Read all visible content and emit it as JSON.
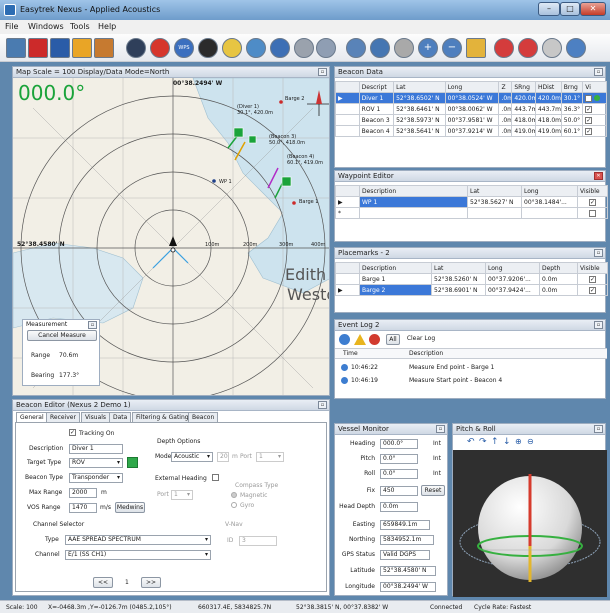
{
  "window": {
    "title": "Easytrek Nexus - Applied Acoustics"
  },
  "menu": [
    "File",
    "Windows",
    "Tools",
    "Help"
  ],
  "map": {
    "header": "Map Scale = 100 Display/Data Mode=North",
    "heading": "000.0°",
    "lon_label": "00°38.2494' W",
    "lat_label": "52°38.4580' N",
    "range_rings": [
      "100m",
      "200m",
      "300m",
      "400m"
    ],
    "labels": {
      "barge2": "Barge 2",
      "diver1": "(Diver 1)\n30.1°, 420.0m",
      "beacon3": "(Beacon 3)\n50.0°, 418.0m",
      "beacon4": "(Beacon 4)\n60.1°, 419.0m",
      "wp1": "WP 1",
      "barge1": "Barge 1"
    },
    "place1": "Edith",
    "place2": "Westo",
    "measurement": {
      "title": "Measurement",
      "cancel": "Cancel Measure",
      "range_label": "Range",
      "range_value": "70.6m",
      "bearing_label": "Bearing",
      "bearing_value": "177.3°"
    }
  },
  "beacon_data": {
    "title": "Beacon Data",
    "columns": [
      "Descript",
      "Lat",
      "Long",
      "Z",
      "SRng",
      "HDist",
      "Brng",
      "Vi"
    ],
    "rows": [
      [
        "Diver 1",
        "52°38.6502' N",
        "00°38.0524' W",
        ".0m",
        "420.0m",
        "420.0m",
        "30.1°"
      ],
      [
        "ROV 1",
        "52°38.6461' N",
        "00°38.0062' W",
        ".0m",
        "443.7m",
        "443.7m",
        "36.3°"
      ],
      [
        "Beacon 3",
        "52°38.5973' N",
        "00°37.9581' W",
        ".0m",
        "418.0m",
        "418.0m",
        "50.0°"
      ],
      [
        "Beacon 4",
        "52°38.5641' N",
        "00°37.9214' W",
        ".0m",
        "419.0m",
        "419.0m",
        "60.1°"
      ]
    ]
  },
  "waypoint_editor": {
    "title": "Waypoint Editor",
    "columns": [
      "Description",
      "Lat",
      "Long",
      "Visible"
    ],
    "rows": [
      [
        "WP 1",
        "52°38.5627' N",
        "00°38.1484'..."
      ]
    ]
  },
  "placemarks": {
    "title": "Placemarks - 2",
    "columns": [
      "Description",
      "Lat",
      "Long",
      "Depth",
      "Visible"
    ],
    "rows": [
      [
        "Barge 1",
        "52°38.5260' N",
        "00°37.9206'...",
        "0.0m"
      ],
      [
        "Barge 2",
        "52°38.6901' N",
        "00°37.9424'...",
        "0.0m"
      ]
    ]
  },
  "event_log": {
    "title": "Event Log 2",
    "all": "All",
    "clear": "Clear Log",
    "columns": [
      "Time",
      "Description"
    ],
    "rows": [
      [
        "10:46:22",
        "Measure End point - Barge 1"
      ],
      [
        "10:46:19",
        "Measure Start point - Beacon 4"
      ]
    ]
  },
  "beacon_editor": {
    "title": "Beacon Editor (Nexus 2 Demo 1)",
    "tabs": [
      "General",
      "Receiver",
      "Visuals",
      "Data",
      "Filtering & Gating",
      "Beacon"
    ],
    "tracking_on": "Tracking On",
    "description_label": "Description",
    "description_value": "Diver 1",
    "target_type_label": "Target Type",
    "target_type_value": "ROV",
    "beacon_type_label": "Beacon Type",
    "beacon_type_value": "Transponder",
    "max_range_label": "Max Range",
    "max_range_value": "2000",
    "max_range_unit": "m",
    "vos_label": "VOS Range",
    "vos_value": "1470",
    "vos_unit": "m/s",
    "medwins": "Medwins",
    "depth_options": "Depth Options",
    "mode_label": "Mode",
    "mode_value": "Acoustic",
    "depth_value": "20",
    "depth_unit": "m",
    "port_label": "Port",
    "port_value": "1",
    "external_heading": "External Heading",
    "ext_port_label": "Port",
    "ext_port_value": "1",
    "compass_type": "Compass Type",
    "magnetic": "Magnetic",
    "gyro": "Gyro",
    "channel_selector": "Channel Selector",
    "type_label": "Type",
    "type_value": "AAE SPREAD SPECTRUM",
    "channel_label": "Channel",
    "channel_value": "E/1 (SS CH1)",
    "vnav": "V-Nav",
    "id_label": "ID",
    "id_value": "3",
    "nav_prev": "<<",
    "nav_page": "1",
    "nav_next": ">>"
  },
  "vessel_monitor": {
    "title": "Vessel Monitor",
    "rows": [
      [
        "Heading",
        "000.0°",
        "Int"
      ],
      [
        "Pitch",
        "0.0°",
        "Int"
      ],
      [
        "Roll",
        "0.0°",
        "Int"
      ],
      [
        "Fix",
        "450",
        ""
      ],
      [
        "Head Depth",
        "0.0m",
        ""
      ],
      [
        "Easting",
        "659849.1m",
        ""
      ],
      [
        "Northing",
        "5834952.1m",
        ""
      ],
      [
        "GPS Status",
        "Valid DGPS",
        ""
      ],
      [
        "Latitude",
        "52°38.4580' N",
        ""
      ],
      [
        "Longitude",
        "00°38.2494' W",
        ""
      ]
    ],
    "reset": "Reset"
  },
  "pitch_roll": {
    "title": "Pitch & Roll"
  },
  "status": {
    "scale": "Scale: 100",
    "xy": "X=-0468.3m ,Y=-0126.7m (0485.2,105°)",
    "en": "660317.4E, 5834825.7N",
    "latlon": "52°38.3815' N, 00°37.8382' W",
    "connected": "Connected",
    "cycle": "Cycle Rate: Fastest"
  },
  "colors": {
    "accent": "#3b78d8",
    "heading": "#1aa33a",
    "titlebar": "#6e9ccb"
  }
}
